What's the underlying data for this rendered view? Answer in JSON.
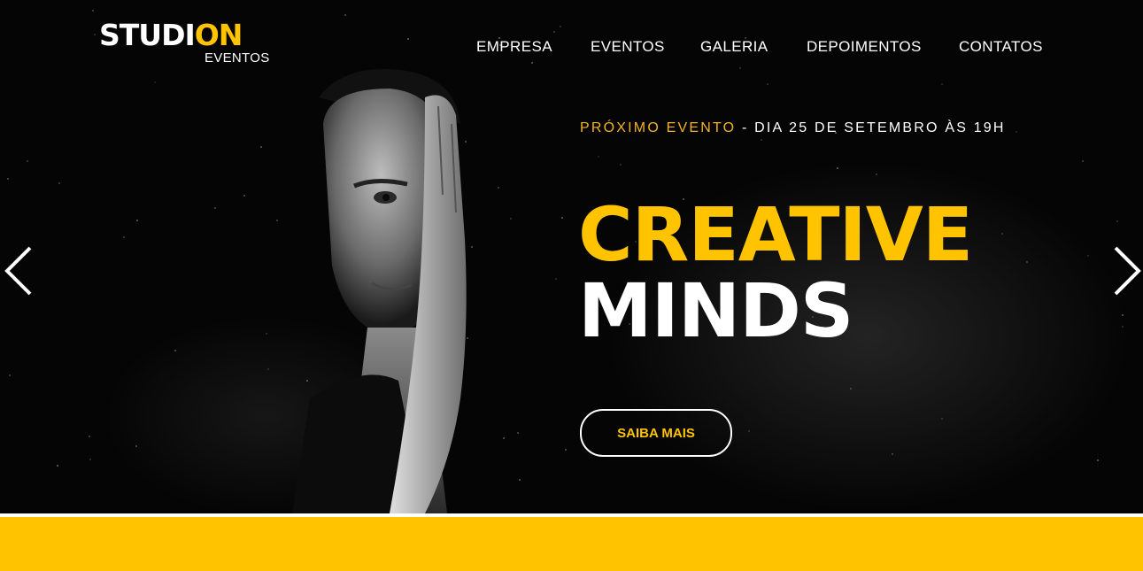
{
  "brand": {
    "name_part1": "STUDI",
    "name_part2": "ON",
    "subtitle": "EVENTOS"
  },
  "nav": {
    "items": [
      {
        "label": "EMPRESA"
      },
      {
        "label": "EVENTOS"
      },
      {
        "label": "GALERIA"
      },
      {
        "label": "DEPOIMENTOS"
      },
      {
        "label": "CONTATOS"
      }
    ]
  },
  "hero": {
    "next_event_label": "PRÓXIMO EVENTO",
    "separator": " - ",
    "next_event_date": "DIA 25 DE SETEMBRO ÀS 19H",
    "headline_line1": "CREATIVE",
    "headline_line2": "MINDS",
    "cta_label": "SAIBA MAIS"
  },
  "carousel": {
    "prev_icon": "chevron-left-icon",
    "next_icon": "chevron-right-icon"
  },
  "colors": {
    "accent": "#ffc300",
    "accent_text": "#f4b425",
    "background": "#000000",
    "text": "#ffffff"
  }
}
